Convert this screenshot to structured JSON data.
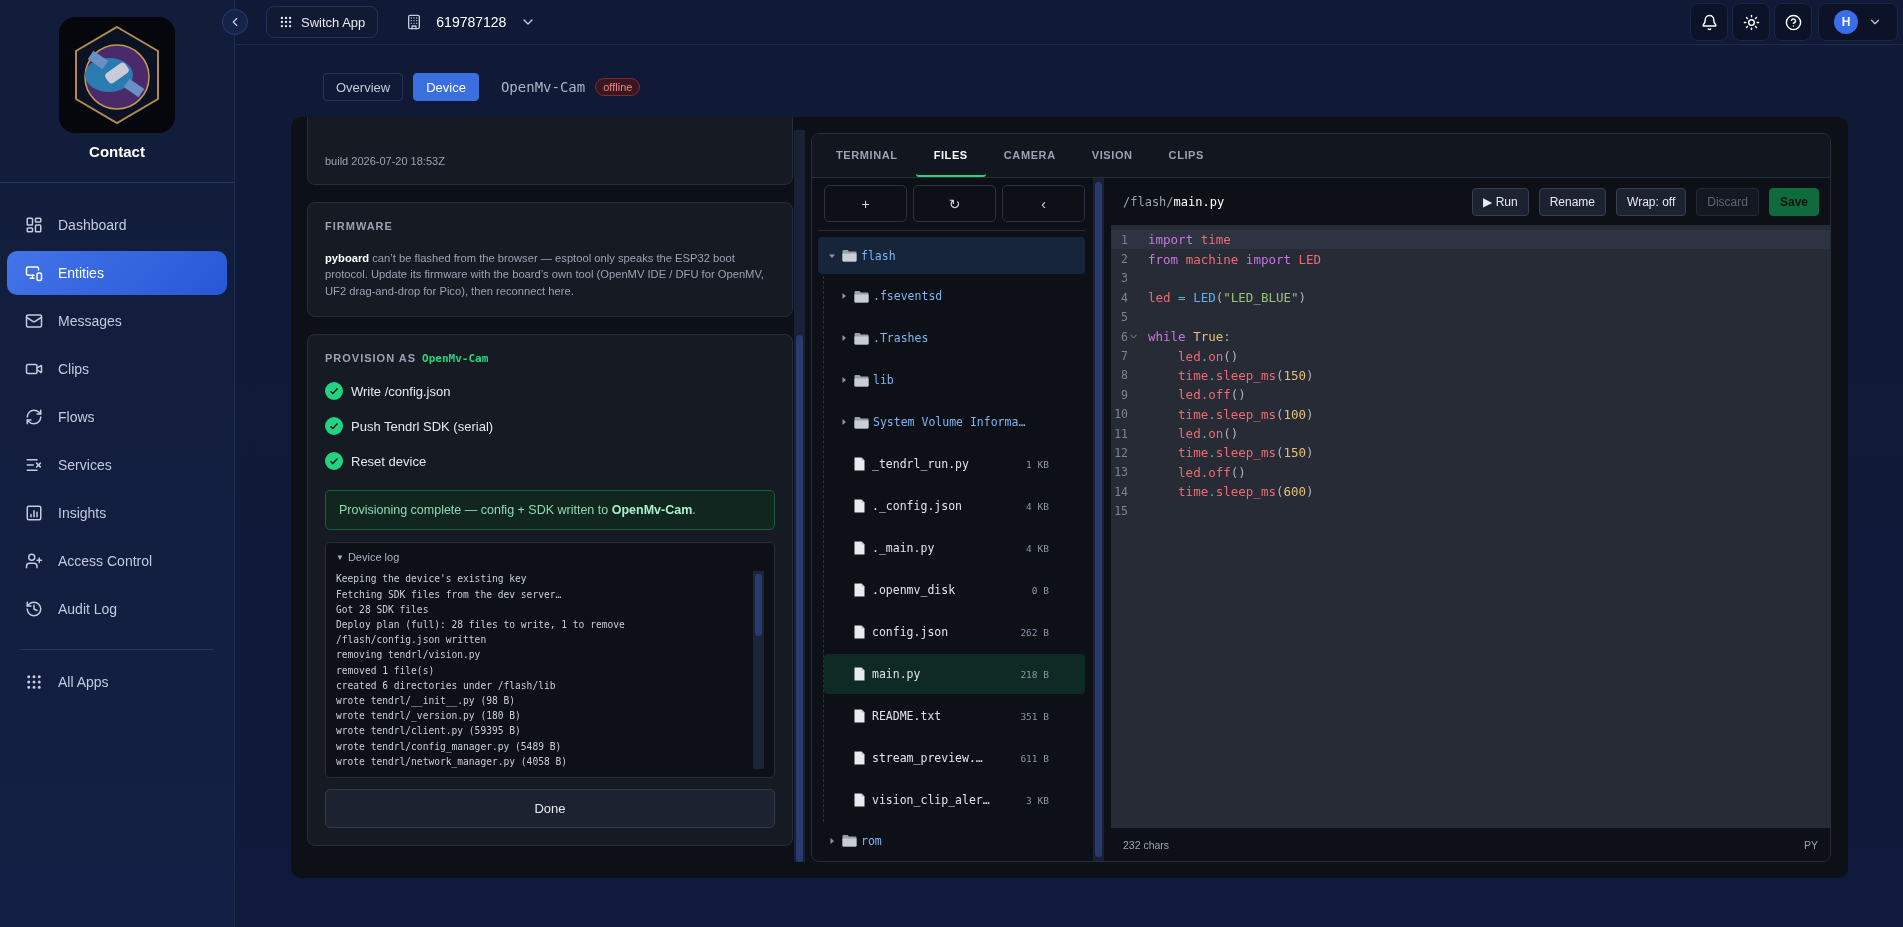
{
  "sidebar": {
    "app_name": "Contact",
    "items": [
      {
        "label": "Dashboard",
        "selected": false
      },
      {
        "label": "Entities",
        "selected": true
      },
      {
        "label": "Messages",
        "selected": false
      },
      {
        "label": "Clips",
        "selected": false
      },
      {
        "label": "Flows",
        "selected": false
      },
      {
        "label": "Services",
        "selected": false
      },
      {
        "label": "Insights",
        "selected": false
      },
      {
        "label": "Access Control",
        "selected": false
      },
      {
        "label": "Audit Log",
        "selected": false
      }
    ],
    "footer_item": {
      "label": "All Apps"
    }
  },
  "topbar": {
    "switch_app": "Switch App",
    "org": "619787128",
    "avatar": "H"
  },
  "page_tabs": [
    {
      "label": "Overview",
      "selected": false
    },
    {
      "label": "Device",
      "selected": true
    }
  ],
  "device": {
    "name": "OpenMv-Cam",
    "status": "offline"
  },
  "board_card": {
    "build": "build 2026-07-20 18:53Z"
  },
  "firmware": {
    "title": "FIRMWARE",
    "text": "**pyboard** can’t be flashed from the browser — esptool only speaks the ESP32 boot protocol. Update its firmware with the board’s own tool (OpenMV IDE / DFU for OpenMV, UF2 drag-and-drop for Pico), then reconnect here."
  },
  "provision": {
    "title": "PROVISION AS",
    "target": "OpenMv-Cam",
    "steps": [
      {
        "label": "Write /config.json",
        "done": true
      },
      {
        "label": "Push Tendrl SDK (serial)",
        "done": true
      },
      {
        "label": "Reset device",
        "done": true
      }
    ],
    "banner": "Provisioning complete — config + SDK written to **OpenMv-Cam**.",
    "log": {
      "marker": "▼",
      "title": "Device log",
      "expanded": true,
      "lines": [
        "Keeping the device's existing key",
        "Fetching SDK files from the dev server…",
        "Got 28 SDK files",
        "Deploy plan (full): 28 files to write, 1 to remove",
        "/flash/config.json written",
        "removing tendrl/vision.py",
        "removed 1 file(s)",
        "created 6 directories under /flash/lib",
        "wrote tendrl/__init__.py (98 B)",
        "wrote tendrl/_version.py (180 B)",
        "wrote tendrl/client.py (59395 B)",
        "wrote tendrl/config_manager.py (5489 B)",
        "wrote tendrl/network_manager.py (4058 B)"
      ]
    },
    "done_button": "Done"
  },
  "panel_tabs": [
    {
      "label": "TERMINAL",
      "selected": false
    },
    {
      "label": "FILES",
      "selected": true
    },
    {
      "label": "CAMERA",
      "selected": false
    },
    {
      "label": "VISION",
      "selected": false
    },
    {
      "label": "CLIPS",
      "selected": false
    }
  ],
  "file_toolbar": [
    "+",
    "↻",
    "‹"
  ],
  "tree": [
    {
      "name": "flash",
      "kind": "folder",
      "expanded": true,
      "current": true,
      "selected": false,
      "children": [
        {
          "name": ".fseventsd",
          "kind": "folder",
          "expanded": false,
          "current": false,
          "selected": false
        },
        {
          "name": ".Trashes",
          "kind": "folder",
          "expanded": false,
          "current": false,
          "selected": false
        },
        {
          "name": "lib",
          "kind": "folder",
          "expanded": false,
          "current": false,
          "selected": false
        },
        {
          "name": "System Volume Informa…",
          "kind": "folder",
          "expanded": false,
          "current": false,
          "selected": false
        },
        {
          "name": "_tendrl_run.py",
          "kind": "file",
          "size": "1 KB",
          "selected": false
        },
        {
          "name": "._config.json",
          "kind": "file",
          "size": "4 KB",
          "selected": false
        },
        {
          "name": "._main.py",
          "kind": "file",
          "size": "4 KB",
          "selected": false
        },
        {
          "name": ".openmv_disk",
          "kind": "file",
          "size": "0 B",
          "selected": false
        },
        {
          "name": "config.json",
          "kind": "file",
          "size": "262 B",
          "selected": false
        },
        {
          "name": "main.py",
          "kind": "file",
          "size": "218 B",
          "selected": true
        },
        {
          "name": "README.txt",
          "kind": "file",
          "size": "351 B",
          "selected": false
        },
        {
          "name": "stream_preview.…",
          "kind": "file",
          "size": "611 B",
          "selected": false
        },
        {
          "name": "vision_clip_aler…",
          "kind": "file",
          "size": "3 KB",
          "selected": false
        }
      ]
    },
    {
      "name": "rom",
      "kind": "folder",
      "expanded": false,
      "current": false,
      "selected": false
    }
  ],
  "editor": {
    "path_dir": "/flash/",
    "path_file": "main.py",
    "buttons": [
      {
        "label": "▶ Run",
        "kind": "plain",
        "disabled": false
      },
      {
        "label": "Rename",
        "kind": "plain",
        "disabled": false
      },
      {
        "label": "Wrap: off",
        "kind": "plain",
        "disabled": false
      },
      {
        "label": "Discard",
        "kind": "plain",
        "disabled": true
      },
      {
        "label": "Save",
        "kind": "primary",
        "disabled": false
      }
    ],
    "lines": [
      {
        "n": "1",
        "active": true,
        "foldable": false,
        "tokens": [
          {
            "text": "import ",
            "kind": "keyword"
          },
          {
            "text": "time",
            "kind": "name"
          }
        ]
      },
      {
        "n": "2",
        "active": false,
        "foldable": false,
        "tokens": [
          {
            "text": "from ",
            "kind": "keyword"
          },
          {
            "text": "machine ",
            "kind": "name"
          },
          {
            "text": "import ",
            "kind": "keyword"
          },
          {
            "text": "LED",
            "kind": "name"
          }
        ]
      },
      {
        "n": "3",
        "active": false,
        "foldable": false
      },
      {
        "n": "4",
        "active": false,
        "foldable": false,
        "tokens": [
          {
            "text": "led ",
            "kind": "name"
          },
          {
            "text": "= ",
            "kind": "op"
          },
          {
            "text": "LED",
            "kind": "func"
          },
          {
            "text": "(",
            "kind": "punct"
          },
          {
            "text": "\"LED_BLUE\"",
            "kind": "string"
          },
          {
            "text": ")",
            "kind": "punct"
          }
        ]
      },
      {
        "n": "5",
        "active": false,
        "foldable": false
      },
      {
        "n": "6",
        "active": false,
        "foldable": true,
        "tokens": [
          {
            "text": "while ",
            "kind": "keyword"
          },
          {
            "text": "True",
            "kind": "const"
          },
          {
            "text": ":",
            "kind": "punct"
          }
        ],
        "children": [
          {
            "n": "7",
            "active": false,
            "foldable": false,
            "tokens": [
              {
                "text": "led",
                "kind": "name"
              },
              {
                "text": ".",
                "kind": "op"
              },
              {
                "text": "on",
                "kind": "name"
              },
              {
                "text": "()",
                "kind": "punct"
              }
            ]
          },
          {
            "n": "8",
            "active": false,
            "foldable": false,
            "tokens": [
              {
                "text": "time",
                "kind": "name"
              },
              {
                "text": ".",
                "kind": "op"
              },
              {
                "text": "sleep_ms",
                "kind": "name"
              },
              {
                "text": "(",
                "kind": "punct"
              },
              {
                "text": "150",
                "kind": "const"
              },
              {
                "text": ")",
                "kind": "punct"
              }
            ]
          },
          {
            "n": "9",
            "active": false,
            "foldable": false,
            "tokens": [
              {
                "text": "led",
                "kind": "name"
              },
              {
                "text": ".off",
                "kind": "name"
              },
              {
                "text": "()",
                "kind": "punct"
              }
            ]
          },
          {
            "n": "10",
            "active": false,
            "foldable": false,
            "tokens": [
              {
                "text": "time",
                "kind": "name"
              },
              {
                "text": ".",
                "kind": "op"
              },
              {
                "text": "sleep_ms",
                "kind": "name"
              },
              {
                "text": "(",
                "kind": "punct"
              },
              {
                "text": "100",
                "kind": "const"
              },
              {
                "text": ")",
                "kind": "punct"
              }
            ]
          },
          {
            "n": "11",
            "active": false,
            "foldable": false,
            "tokens": [
              {
                "text": "led",
                "kind": "name"
              },
              {
                "text": ".",
                "kind": "op"
              },
              {
                "text": "on",
                "kind": "name"
              },
              {
                "text": "()",
                "kind": "punct"
              }
            ]
          },
          {
            "n": "12",
            "active": false,
            "foldable": false,
            "tokens": [
              {
                "text": "time",
                "kind": "name"
              },
              {
                "text": ".",
                "kind": "op"
              },
              {
                "text": "sleep_ms",
                "kind": "name"
              },
              {
                "text": "(",
                "kind": "punct"
              },
              {
                "text": "150",
                "kind": "const"
              },
              {
                "text": ")",
                "kind": "punct"
              }
            ]
          },
          {
            "n": "13",
            "active": false,
            "foldable": false,
            "tokens": [
              {
                "text": "led",
                "kind": "name"
              },
              {
                "text": ".off",
                "kind": "name"
              },
              {
                "text": "()",
                "kind": "punct"
              }
            ]
          },
          {
            "n": "14",
            "active": false,
            "foldable": false,
            "tokens": [
              {
                "text": "time",
                "kind": "name"
              },
              {
                "text": ".",
                "kind": "op"
              },
              {
                "text": "sleep_ms",
                "kind": "name"
              },
              {
                "text": "(",
                "kind": "punct"
              },
              {
                "text": "600",
                "kind": "const"
              },
              {
                "text": ")",
                "kind": "punct"
              }
            ]
          }
        ]
      },
      {
        "n": "15",
        "active": false,
        "foldable": false
      }
    ],
    "char_count": "232 chars",
    "language": "PY"
  }
}
